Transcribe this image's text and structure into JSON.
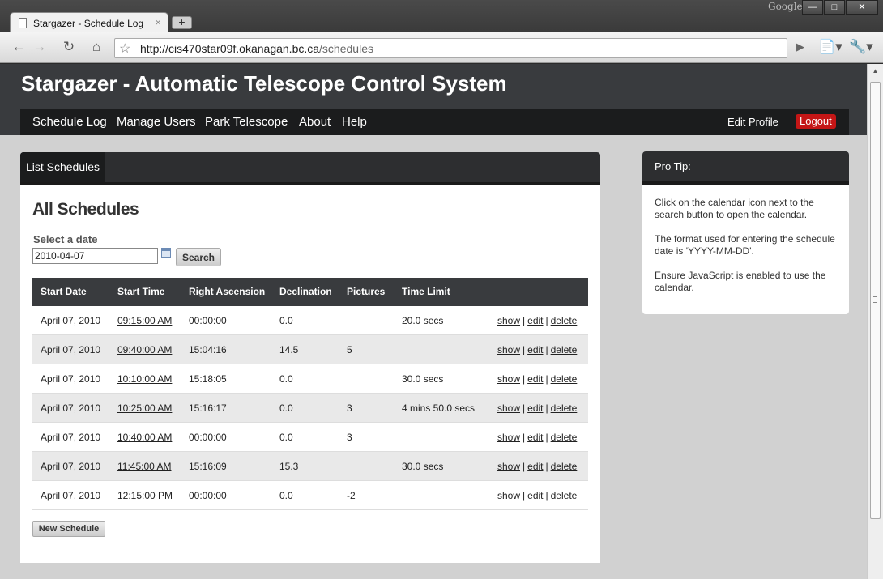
{
  "browser": {
    "tab_title": "Stargazer - Schedule Log",
    "tab_close": "×",
    "new_tab": "+",
    "brand": "Google",
    "url_host": "http://cis470star09f.okanagan.bc.ca",
    "url_path": "/schedules"
  },
  "site": {
    "title": "Stargazer - Automatic Telescope Control System",
    "nav": [
      "Schedule Log",
      "Manage Users",
      "Park Telescope",
      "About",
      "Help"
    ],
    "edit_profile": "Edit Profile",
    "logout": "Logout"
  },
  "main": {
    "tab_label": "List Schedules",
    "heading": "All Schedules",
    "date_label": "Select a date",
    "date_value": "2010-04-07",
    "search_label": "Search",
    "columns": [
      "Start Date",
      "Start Time",
      "Right Ascension",
      "Declination",
      "Pictures",
      "Time Limit"
    ],
    "actions": {
      "show": "show",
      "edit": "edit",
      "delete": "delete",
      "sep": "|"
    },
    "rows": [
      {
        "date": "April 07, 2010",
        "time": "09:15:00 AM",
        "ra": "00:00:00",
        "dec": "0.0",
        "pictures": "",
        "limit": "20.0 secs"
      },
      {
        "date": "April 07, 2010",
        "time": "09:40:00 AM",
        "ra": "15:04:16",
        "dec": "14.5",
        "pictures": "5",
        "limit": ""
      },
      {
        "date": "April 07, 2010",
        "time": "10:10:00 AM",
        "ra": "15:18:05",
        "dec": "0.0",
        "pictures": "",
        "limit": "30.0 secs"
      },
      {
        "date": "April 07, 2010",
        "time": "10:25:00 AM",
        "ra": "15:16:17",
        "dec": "0.0",
        "pictures": "3",
        "limit": "4 mins 50.0 secs"
      },
      {
        "date": "April 07, 2010",
        "time": "10:40:00 AM",
        "ra": "00:00:00",
        "dec": "0.0",
        "pictures": "3",
        "limit": ""
      },
      {
        "date": "April 07, 2010",
        "time": "11:45:00 AM",
        "ra": "15:16:09",
        "dec": "15.3",
        "pictures": "",
        "limit": "30.0 secs"
      },
      {
        "date": "April 07, 2010",
        "time": "12:15:00 PM",
        "ra": "00:00:00",
        "dec": "0.0",
        "pictures": "-2",
        "limit": ""
      }
    ],
    "new_button": "New Schedule"
  },
  "sidebar": {
    "title": "Pro Tip:",
    "paragraphs": [
      "Click on the calendar icon next to the search button to open the calendar.",
      "The format used for entering the schedule date is 'YYYY-MM-DD'.",
      "Ensure JavaScript is enabled to use the calendar."
    ]
  }
}
